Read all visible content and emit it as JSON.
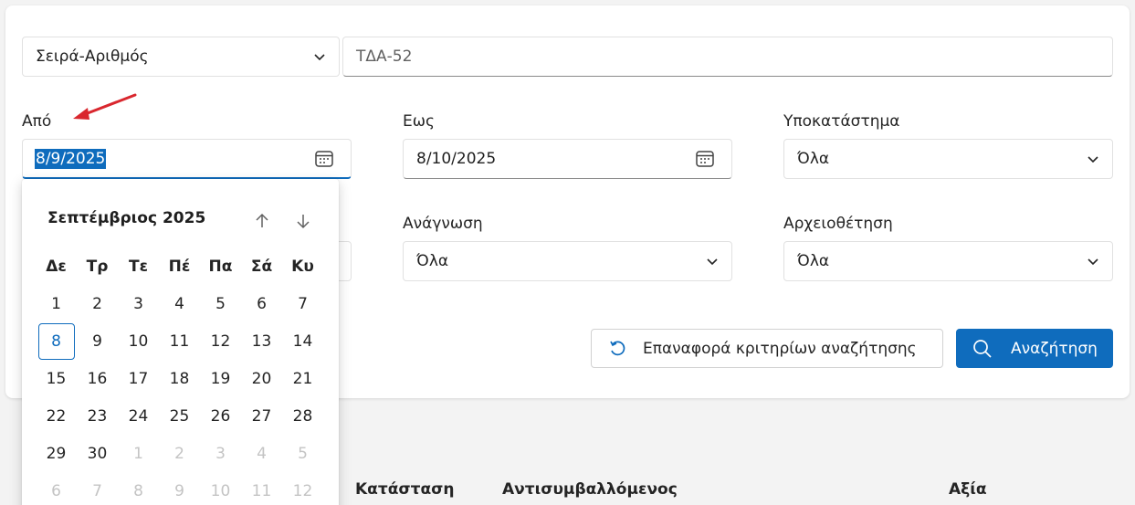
{
  "search_type": {
    "value": "Σειρά-Αριθμός"
  },
  "search_text": {
    "value": "ΤΔΑ-52"
  },
  "from": {
    "label": "Από",
    "value": "8/9/2025"
  },
  "to": {
    "label": "Εως",
    "value": "8/10/2025"
  },
  "branch": {
    "label": "Υποκατάστημα",
    "value": "Όλα"
  },
  "reading": {
    "label": "Ανάγνωση",
    "value": "Όλα"
  },
  "archiving": {
    "label": "Αρχειοθέτηση",
    "value": "Όλα"
  },
  "reset_button": {
    "label": "Επαναφορά κριτηρίων αναζήτησης"
  },
  "search_button": {
    "label": "Αναζήτηση"
  },
  "calendar": {
    "month_title": "Σεπτέμβριος 2025",
    "weekdays": [
      "Δε",
      "Τρ",
      "Τε",
      "Πέ",
      "Πα",
      "Σά",
      "Κυ"
    ],
    "days": [
      [
        "1",
        "2",
        "3",
        "4",
        "5",
        "6",
        "7"
      ],
      [
        "8",
        "9",
        "10",
        "11",
        "12",
        "13",
        "14"
      ],
      [
        "15",
        "16",
        "17",
        "18",
        "19",
        "20",
        "21"
      ],
      [
        "22",
        "23",
        "24",
        "25",
        "26",
        "27",
        "28"
      ],
      [
        "29",
        "30",
        "1",
        "2",
        "3",
        "4",
        "5"
      ],
      [
        "6",
        "7",
        "8",
        "9",
        "10",
        "11",
        "12"
      ]
    ],
    "today": "8"
  },
  "table_headers": [
    "Κατάσταση",
    "Αντισυμβαλλόμενος",
    "Αξία"
  ],
  "colors": {
    "accent": "#0f6cbd",
    "annotation_arrow": "#d9272e"
  }
}
